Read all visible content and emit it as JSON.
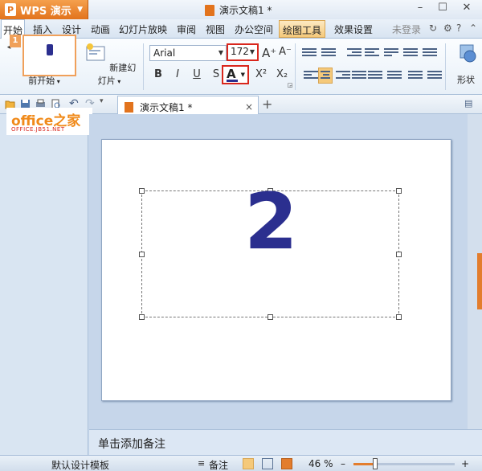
{
  "titlebar": {
    "app_button": "WPS 演示",
    "doc_title": "演示文稿1 *",
    "minimize": "–",
    "restore": "☐",
    "close": "✕"
  },
  "menu": {
    "items": [
      "开始",
      "插入",
      "设计",
      "动画",
      "幻灯片放映",
      "审阅",
      "视图",
      "办公空间",
      "绘图工具",
      "效果设置"
    ],
    "login": "未登录"
  },
  "ribbon": {
    "from_current": "从当前开始",
    "new_slide": "新建幻灯片",
    "font_name": "Arial",
    "font_size": "172",
    "bold": "B",
    "italic": "I",
    "underline": "U",
    "strike": "S",
    "font_color_letter": "A",
    "grow": "A⁺",
    "shrink": "A⁻",
    "superscript": "X²",
    "subscript": "X₂",
    "shape": "形状",
    "accent_color": "#2b2f8f"
  },
  "qat": {
    "doc_tab": "演示文稿1 *",
    "tab_close": "×",
    "new_tab": "+"
  },
  "left_panel": {
    "close": "×",
    "slide_number": "1",
    "watermark_main": "office之家",
    "watermark_sub": "OFFICE.JB51.NET"
  },
  "slide": {
    "text": "2"
  },
  "notes": {
    "placeholder": "单击添加备注"
  },
  "status": {
    "template": "默认设计模板",
    "notes_label": "备注",
    "zoom": "46 %",
    "zoom_minus": "–",
    "zoom_plus": "+"
  }
}
